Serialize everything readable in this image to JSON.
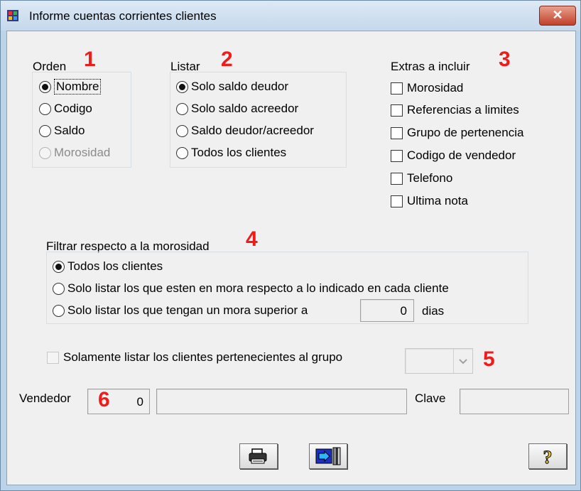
{
  "window": {
    "title": "Informe cuentas corrientes clientes",
    "close_label": "✕"
  },
  "orden": {
    "legend": "Orden",
    "number": "1",
    "options": [
      {
        "label": "Nombre",
        "checked": true
      },
      {
        "label": "Codigo",
        "checked": false
      },
      {
        "label": "Saldo",
        "checked": false
      },
      {
        "label": "Morosidad",
        "checked": false,
        "disabled": true
      }
    ]
  },
  "listar": {
    "legend": "Listar",
    "number": "2",
    "options": [
      {
        "label": "Solo saldo deudor",
        "checked": true
      },
      {
        "label": "Solo saldo acreedor",
        "checked": false
      },
      {
        "label": "Saldo deudor/acreedor",
        "checked": false
      },
      {
        "label": "Todos los clientes",
        "checked": false
      }
    ]
  },
  "extras": {
    "legend": "Extras a incluir",
    "number": "3",
    "options": [
      "Morosidad",
      "Referencias a limites",
      "Grupo de pertenencia",
      "Codigo de vendedor",
      "Telefono",
      "Ultima nota"
    ]
  },
  "filtrar": {
    "legend": "Filtrar respecto a la morosidad",
    "number": "4",
    "options": [
      {
        "label": "Todos los clientes",
        "checked": true
      },
      {
        "label": "Solo listar los que esten en mora respecto a lo indicado en cada cliente",
        "checked": false
      },
      {
        "label": "Solo listar los que tengan un mora superior a",
        "checked": false
      }
    ],
    "days_value": "0",
    "days_label": "dias"
  },
  "grupo": {
    "label": "Solamente listar los clientes pertenecientes al grupo",
    "number": "5",
    "selected": ""
  },
  "vendedor": {
    "label": "Vendedor",
    "number": "6",
    "code": "0",
    "name": "",
    "clave_label": "Clave",
    "clave": ""
  },
  "icons": {
    "print": "printer-icon",
    "exit": "exit-door-icon",
    "help": "help-question-icon"
  },
  "colors": {
    "accent_number": "#f01b1b",
    "titlebar": "#c5d8ec",
    "close": "#c1402a"
  }
}
